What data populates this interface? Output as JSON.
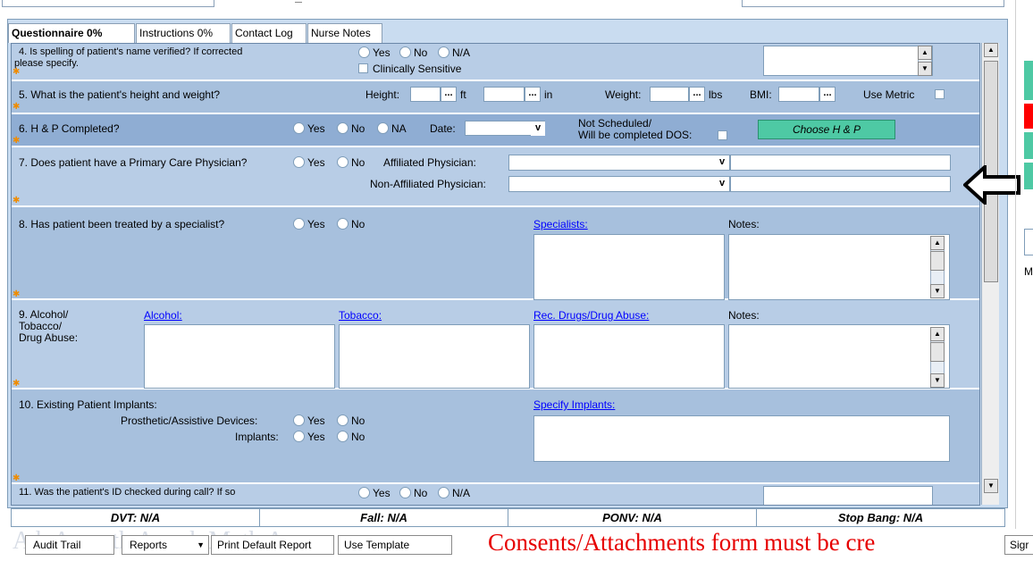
{
  "tabs": [
    {
      "label": "Questionnaire 0%"
    },
    {
      "label": "Instructions 0%"
    },
    {
      "label": "Contact Log"
    },
    {
      "label": "Nurse Notes"
    }
  ],
  "q4": {
    "text_line1": "4. Is spelling of patient's name verified? If corrected",
    "text_line2": "please specify.",
    "yes": "Yes",
    "no": "No",
    "na": "N/A",
    "clinically_sensitive": "Clinically Sensitive"
  },
  "q5": {
    "text": "5. What is the patient's height and weight?",
    "height_label": "Height:",
    "ft": "ft",
    "in": "in",
    "weight_label": "Weight:",
    "lbs": "lbs",
    "bmi_label": "BMI:",
    "use_metric": "Use Metric",
    "ellipsis": "..."
  },
  "q6": {
    "text": "6. H & P Completed?",
    "yes": "Yes",
    "no": "No",
    "na": "NA",
    "date_label": "Date:",
    "not_scheduled_1": "Not Scheduled/",
    "not_scheduled_2": "Will be completed DOS:",
    "choose_button": "Choose H & P"
  },
  "q7": {
    "text": "7. Does patient have a Primary Care Physician?",
    "yes": "Yes",
    "no": "No",
    "affiliated_label": "Affiliated Physician:",
    "non_affiliated_label": "Non-Affiliated Physician:"
  },
  "q8": {
    "text": "8. Has patient been treated by a specialist?",
    "yes": "Yes",
    "no": "No",
    "specialists_link": "Specialists:",
    "notes_label": "Notes:"
  },
  "q9": {
    "text_line1": "9. Alcohol/",
    "text_line2": "Tobacco/",
    "text_line3": "Drug Abuse:",
    "alcohol_link": "Alcohol:",
    "tobacco_link": "Tobacco:",
    "drugs_link": "Rec. Drugs/Drug Abuse:",
    "notes_label": "Notes:"
  },
  "q10": {
    "text": "10. Existing Patient Implants:",
    "prosthetic_label": "Prosthetic/Assistive Devices:",
    "implants_label": "Implants:",
    "yes": "Yes",
    "no": "No",
    "specify_link": "Specify Implants:"
  },
  "q11": {
    "text": "11. Was the patient's ID checked during call? If so",
    "yes": "Yes",
    "no": "No",
    "na": "N/A"
  },
  "risk": {
    "dvt": "DVT: N/A",
    "fall": "Fall: N/A",
    "ponv": "PONV: N/A",
    "stop_bang": "Stop Bang: N/A"
  },
  "bottom": {
    "audit_trail": "Audit Trail",
    "reports": "Reports",
    "print_default": "Print Default Report",
    "use_template": "Use Template",
    "warning": "Consents/Attachments form must be cre",
    "sign": "Sigr",
    "watermark": "A          k Aag    ath A    arch Math A"
  },
  "side": {
    "m_label": "M"
  },
  "colors": {
    "accent_green": "#4ec9a4",
    "warning_red": "#e60000",
    "link_blue": "#0000ff",
    "star_orange": "#f08c00"
  }
}
